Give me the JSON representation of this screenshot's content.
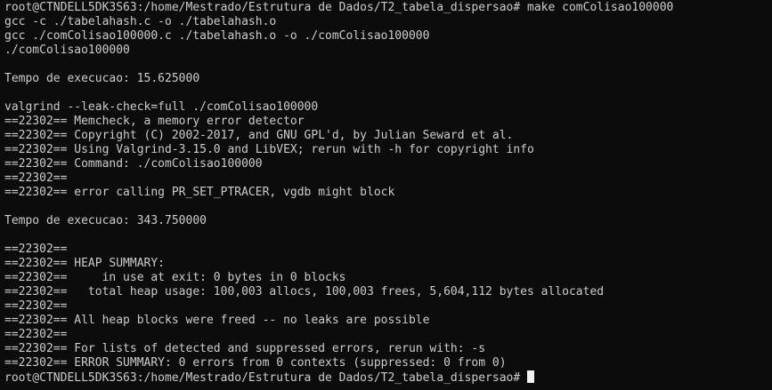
{
  "terminal": {
    "lines": [
      "root@CTNDELL5DK3S63:/home/Mestrado/Estrutura de Dados/T2_tabela_dispersao# make comColisao100000",
      "gcc -c ./tabelahash.c -o ./tabelahash.o",
      "gcc ./comColisao100000.c ./tabelahash.o -o ./comColisao100000",
      "./comColisao100000",
      "",
      "Tempo de execucao: 15.625000",
      "",
      "valgrind --leak-check=full ./comColisao100000",
      "==22302== Memcheck, a memory error detector",
      "==22302== Copyright (C) 2002-2017, and GNU GPL'd, by Julian Seward et al.",
      "==22302== Using Valgrind-3.15.0 and LibVEX; rerun with -h for copyright info",
      "==22302== Command: ./comColisao100000",
      "==22302==",
      "==22302== error calling PR_SET_PTRACER, vgdb might block",
      "",
      "Tempo de execucao: 343.750000",
      "",
      "==22302==",
      "==22302== HEAP SUMMARY:",
      "==22302==     in use at exit: 0 bytes in 0 blocks",
      "==22302==   total heap usage: 100,003 allocs, 100,003 frees, 5,604,112 bytes allocated",
      "==22302==",
      "==22302== All heap blocks were freed -- no leaks are possible",
      "==22302==",
      "==22302== For lists of detected and suppressed errors, rerun with: -s",
      "==22302== ERROR SUMMARY: 0 errors from 0 contexts (suppressed: 0 from 0)"
    ],
    "prompt": "root@CTNDELL5DK3S63:/home/Mestrado/Estrutura de Dados/T2_tabela_dispersao# ",
    "colors": {
      "background": "#0c0c0c",
      "foreground": "#cccccc",
      "cursor": "#f2f2f2"
    }
  }
}
